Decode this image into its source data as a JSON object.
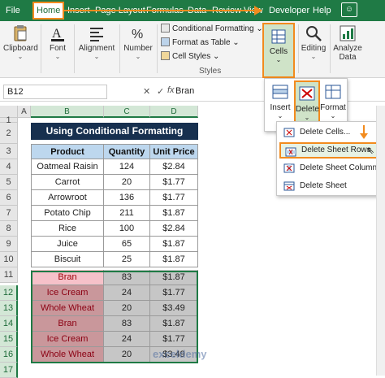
{
  "menu": {
    "items": [
      "File",
      "Home",
      "Insert",
      "Page Layout",
      "Formulas",
      "Data",
      "Review",
      "View",
      "Developer",
      "Help"
    ]
  },
  "ribbon": {
    "clipboard": "Clipboard",
    "font": "Font",
    "alignment": "Alignment",
    "number": "Number",
    "conditional_formatting": "Conditional Formatting",
    "format_as_table": "Format as Table",
    "cell_styles": "Cell Styles",
    "styles_group": "Styles",
    "cells": "Cells",
    "editing": "Editing",
    "analyze_data": "Analyze Data"
  },
  "formula_bar": {
    "name_box": "B12",
    "cancel": "✕",
    "enter": "✓",
    "fx": "fx",
    "value": "Bran"
  },
  "columns": [
    "A",
    "B",
    "C",
    "D"
  ],
  "rows": [
    "1",
    "2",
    "3",
    "4",
    "5",
    "6",
    "7",
    "8",
    "9",
    "10",
    "11",
    "12",
    "13",
    "14",
    "15",
    "16",
    "17"
  ],
  "sheet": {
    "title": "Using Conditional Formatting",
    "headers": [
      "Product",
      "Quantity",
      "Unit Price"
    ],
    "data": [
      {
        "product": "Oatmeal Raisin",
        "qty": "124",
        "price": "$2.84",
        "style": "normal"
      },
      {
        "product": "Carrot",
        "qty": "20",
        "price": "$1.77",
        "style": "normal"
      },
      {
        "product": "Arrowroot",
        "qty": "136",
        "price": "$1.77",
        "style": "normal"
      },
      {
        "product": "Potato Chip",
        "qty": "211",
        "price": "$1.87",
        "style": "normal"
      },
      {
        "product": "Rice",
        "qty": "100",
        "price": "$2.84",
        "style": "normal"
      },
      {
        "product": "Juice",
        "qty": "65",
        "price": "$1.87",
        "style": "normal"
      },
      {
        "product": "Biscuit",
        "qty": "25",
        "price": "$1.87",
        "style": "normal"
      },
      {
        "product": "Bran",
        "qty": "83",
        "price": "$1.87",
        "style": "pink"
      },
      {
        "product": "Ice Cream",
        "qty": "24",
        "price": "$1.77",
        "style": "red"
      },
      {
        "product": "Whole Wheat",
        "qty": "20",
        "price": "$3.49",
        "style": "red"
      },
      {
        "product": "Bran",
        "qty": "83",
        "price": "$1.87",
        "style": "red"
      },
      {
        "product": "Ice Cream",
        "qty": "24",
        "price": "$1.77",
        "style": "red"
      },
      {
        "product": "Whole Wheat",
        "qty": "20",
        "price": "$3.49",
        "style": "red"
      }
    ]
  },
  "cells_panel": {
    "insert": "Insert",
    "delete": "Delete",
    "format": "Format"
  },
  "delete_menu": {
    "items": [
      "Delete Cells...",
      "Delete Sheet Rows",
      "Delete Sheet Columns",
      "Delete Sheet"
    ]
  },
  "watermark": "exceldemy",
  "colors": {
    "excel_green": "#1f7a45",
    "highlight_orange": "#f28b1e",
    "title_navy": "#17304f",
    "header_blue": "#bdd7ee"
  }
}
